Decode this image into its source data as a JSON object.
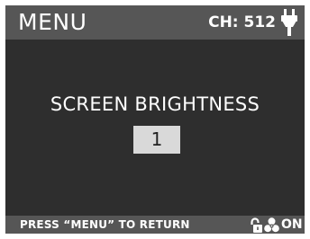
{
  "header": {
    "title": "MENU",
    "channel": "CH: 512",
    "power_icon": "plug-icon"
  },
  "main": {
    "setting_title": "SCREEN BRIGHTNESS",
    "setting_value": "1"
  },
  "footer": {
    "hint": "PRESS “MENU” TO RETURN",
    "lock_icon": "unlocked-padlock-icon",
    "fan_icon": "fan-icon",
    "fan_state": "ON"
  },
  "colors": {
    "screen_background": "#2e2e2e",
    "bar_background": "#565656",
    "value_box_background": "#d9d9d9",
    "text": "#ffffff"
  }
}
